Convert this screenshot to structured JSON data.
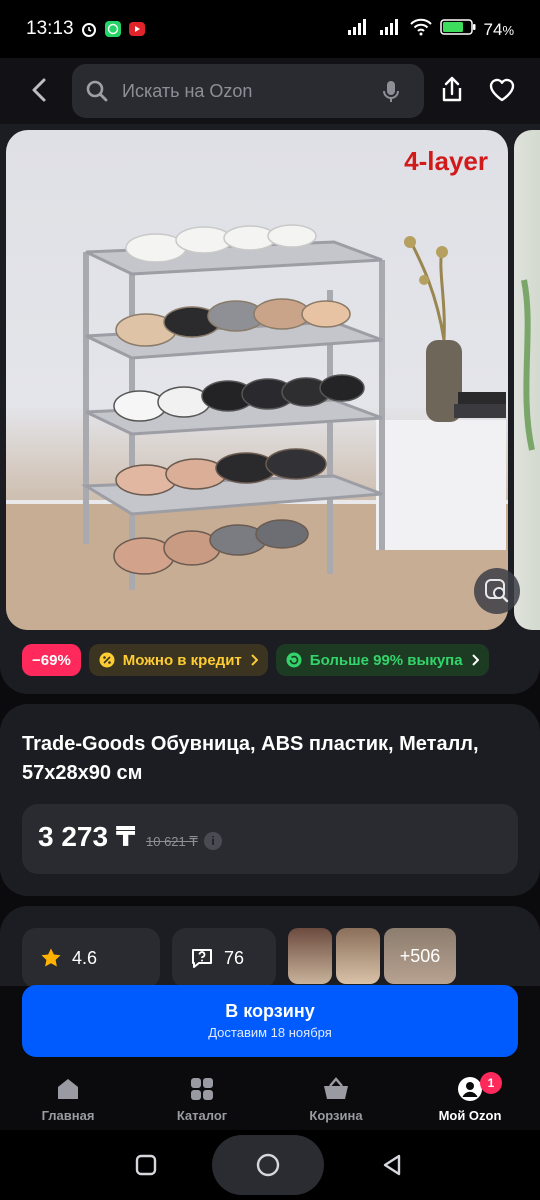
{
  "status_bar": {
    "time": "13:13",
    "battery": "74",
    "battery_unit": "%"
  },
  "header": {
    "search_placeholder": "Искать на Ozon"
  },
  "product": {
    "image_overlay_text": "4-layer",
    "badges": {
      "discount": "−69%",
      "credit": "Можно в кредит",
      "buyout": "Больше 99% выкупа"
    },
    "title": "Trade-Goods Обувница, ABS пластик, Металл, 57x28x90 см",
    "price": "3 273 ₸",
    "old_price": "10 621 ₸",
    "rating": "4.6",
    "questions": "76",
    "photos_more": "+506"
  },
  "cart_button": {
    "label": "В корзину",
    "sublabel": "Доставим 18 ноября"
  },
  "tabs": [
    {
      "label": "Главная"
    },
    {
      "label": "Каталог"
    },
    {
      "label": "Корзина"
    },
    {
      "label": "Мой Ozon"
    }
  ],
  "notification_count": "1",
  "colors": {
    "accent": "#005bff",
    "discount": "#ff2a5b",
    "credit": "#ffcc33",
    "buyout": "#33d46b"
  }
}
